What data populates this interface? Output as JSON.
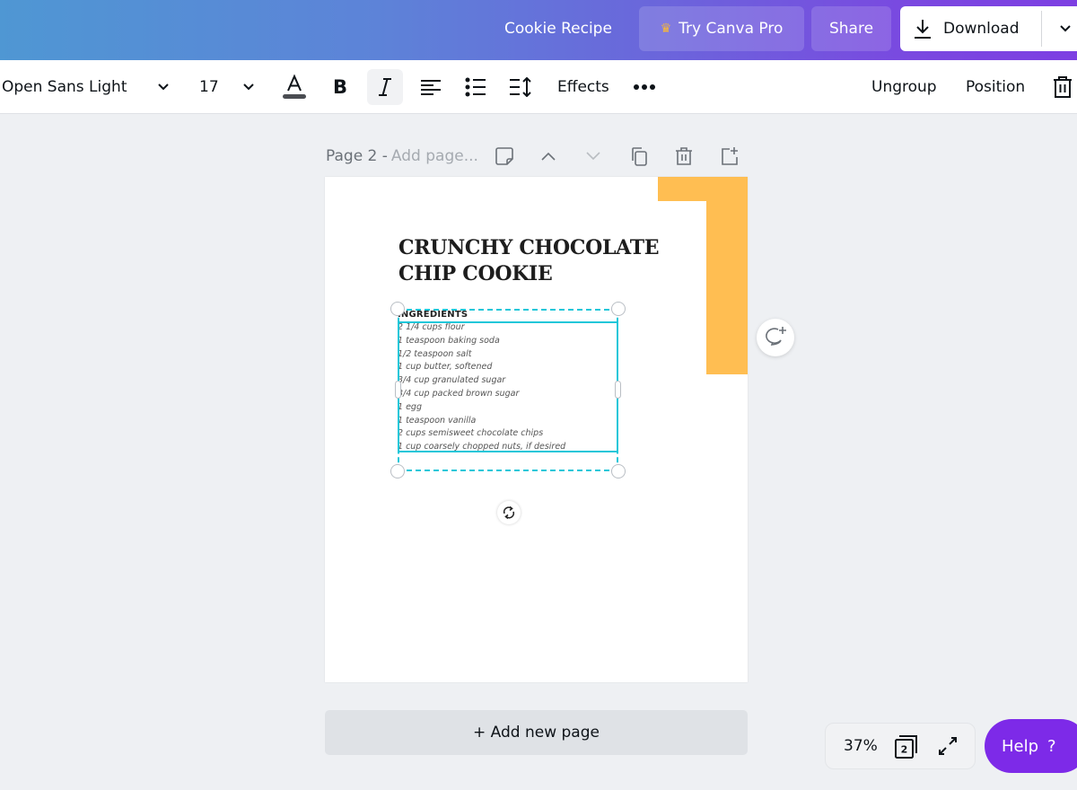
{
  "header": {
    "doc_title": "Cookie Recipe",
    "try_pro_label": "Try Canva Pro",
    "share_label": "Share",
    "download_label": "Download"
  },
  "toolbar": {
    "font_family": "Open Sans Light",
    "font_size": "17",
    "effects_label": "Effects",
    "ungroup_label": "Ungroup",
    "position_label": "Position"
  },
  "page_header": {
    "page_label": "Page 2 -",
    "title_placeholder": "Add page..."
  },
  "canvas": {
    "title_line1": "CRUNCHY CHOCOLATE",
    "title_line2": "CHIP COOKIE",
    "ingredients_heading": "INGREDIENTS",
    "ingredients": [
      "2 1/4 cups flour",
      "1 teaspoon baking soda",
      "1/2 teaspoon salt",
      "1 cup butter, softened",
      "3/4 cup granulated sugar",
      "3/4 cup packed brown sugar",
      "1 egg",
      "1 teaspoon vanilla",
      "2 cups semisweet chocolate chips",
      "1 cup coarsely chopped nuts, if desired"
    ],
    "accent_color": "#ffbe52",
    "selection_color": "#1ec7d9"
  },
  "footer": {
    "add_page_label": "+ Add new page",
    "zoom_level": "37%",
    "page_count": "2",
    "help_label": "Help",
    "help_symbol": "?"
  },
  "colors": {
    "brand_purple": "#7d2ae8"
  }
}
